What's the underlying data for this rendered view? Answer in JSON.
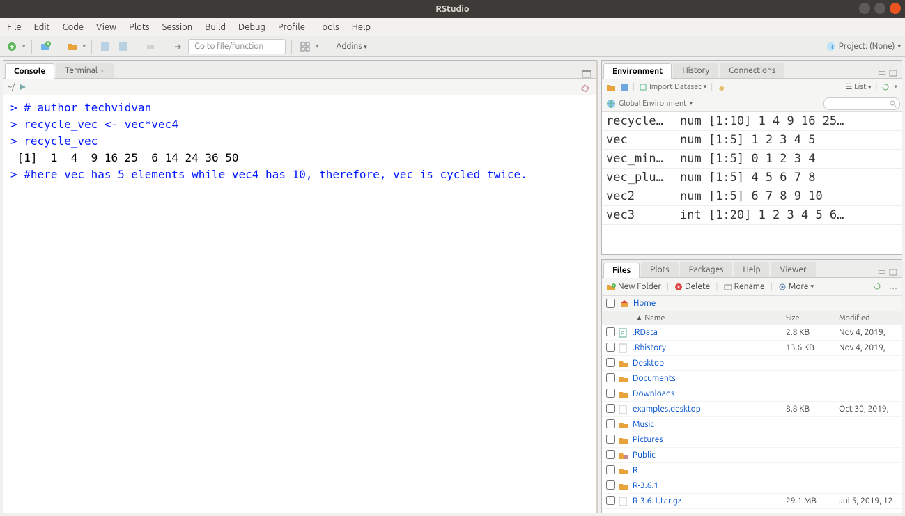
{
  "window": {
    "title": "RStudio"
  },
  "menu": {
    "file": "File",
    "edit": "Edit",
    "code": "Code",
    "view": "View",
    "plots": "Plots",
    "session": "Session",
    "build": "Build",
    "debug": "Debug",
    "profile": "Profile",
    "tools": "Tools",
    "help": "Help"
  },
  "toolbar": {
    "goto_placeholder": "Go to file/function",
    "addins": "Addins",
    "project": "Project: (None)"
  },
  "console": {
    "tabs": {
      "console": "Console",
      "terminal": "Terminal"
    },
    "path": "~/",
    "lines": [
      {
        "type": "prompt",
        "text": "> # author techvidvan"
      },
      {
        "type": "prompt",
        "text": "> recycle_vec <- vec*vec4"
      },
      {
        "type": "prompt",
        "text": "> recycle_vec"
      },
      {
        "type": "out",
        "text": " [1]  1  4  9 16 25  6 14 24 36 50"
      },
      {
        "type": "prompt",
        "text": "> #here vec has 5 elements while vec4 has 10, therefore, vec is cycled twice."
      }
    ]
  },
  "env": {
    "tabs": {
      "environment": "Environment",
      "history": "History",
      "connections": "Connections"
    },
    "import": "Import Dataset",
    "list": "List",
    "scope": "Global Environment",
    "vars": [
      {
        "name": "recycle…",
        "value": "num [1:10] 1 4 9 16 25…"
      },
      {
        "name": "vec",
        "value": "num [1:5] 1 2 3 4 5"
      },
      {
        "name": "vec_min…",
        "value": "num [1:5] 0 1 2 3 4"
      },
      {
        "name": "vec_plu…",
        "value": "num [1:5] 4 5 6 7 8"
      },
      {
        "name": "vec2",
        "value": "num [1:5] 6 7 8 9 10"
      },
      {
        "name": "vec3",
        "value": "int [1:20] 1 2 3 4 5 6…"
      }
    ]
  },
  "files": {
    "tabs": {
      "files": "Files",
      "plots": "Plots",
      "packages": "Packages",
      "help": "Help",
      "viewer": "Viewer"
    },
    "buttons": {
      "newfolder": "New Folder",
      "delete": "Delete",
      "rename": "Rename",
      "more": "More"
    },
    "breadcrumb": "Home",
    "headers": {
      "name": "Name",
      "size": "Size",
      "modified": "Modified"
    },
    "items": [
      {
        "icon": "rdata",
        "name": ".RData",
        "size": "2.8 KB",
        "modified": "Nov 4, 2019,"
      },
      {
        "icon": "file",
        "name": ".Rhistory",
        "size": "13.6 KB",
        "modified": "Nov 4, 2019,"
      },
      {
        "icon": "folder",
        "name": "Desktop",
        "size": "",
        "modified": ""
      },
      {
        "icon": "folder",
        "name": "Documents",
        "size": "",
        "modified": ""
      },
      {
        "icon": "folder",
        "name": "Downloads",
        "size": "",
        "modified": ""
      },
      {
        "icon": "file",
        "name": "examples.desktop",
        "size": "8.8 KB",
        "modified": "Oct 30, 2019,"
      },
      {
        "icon": "folder",
        "name": "Music",
        "size": "",
        "modified": ""
      },
      {
        "icon": "folder",
        "name": "Pictures",
        "size": "",
        "modified": ""
      },
      {
        "icon": "folder-lock",
        "name": "Public",
        "size": "",
        "modified": ""
      },
      {
        "icon": "folder",
        "name": "R",
        "size": "",
        "modified": ""
      },
      {
        "icon": "folder",
        "name": "R-3.6.1",
        "size": "",
        "modified": ""
      },
      {
        "icon": "file",
        "name": "R-3.6.1.tar.gz",
        "size": "29.1 MB",
        "modified": "Jul 5, 2019, 12"
      }
    ]
  }
}
